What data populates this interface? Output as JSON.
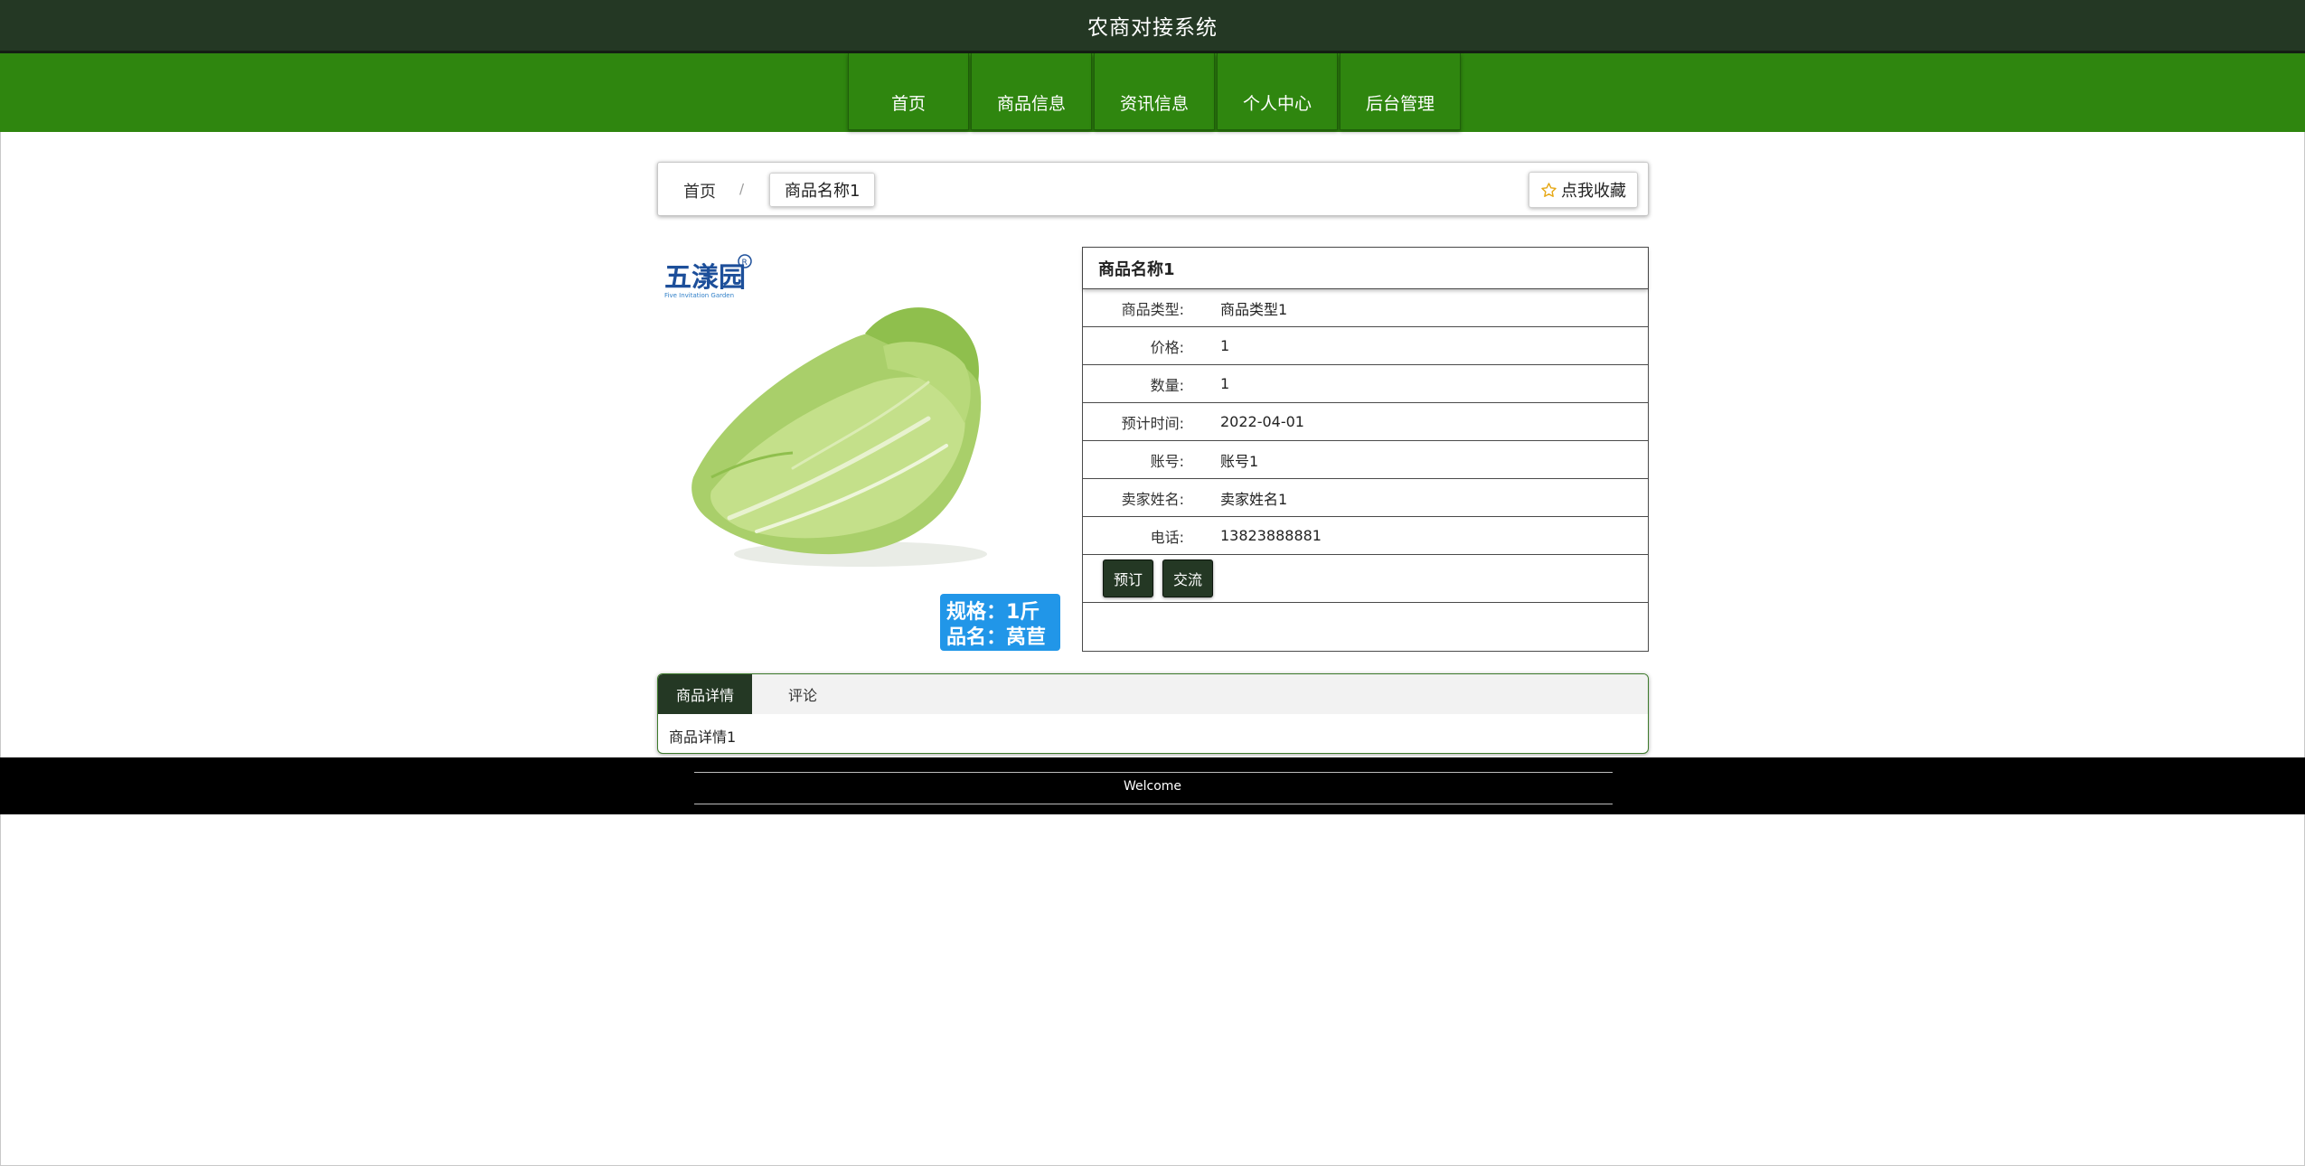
{
  "header": {
    "title": "农商对接系统"
  },
  "nav": {
    "items": [
      {
        "label": "首页"
      },
      {
        "label": "商品信息"
      },
      {
        "label": "资讯信息"
      },
      {
        "label": "个人中心"
      },
      {
        "label": "后台管理"
      }
    ]
  },
  "breadcrumb": {
    "home": "首页",
    "separator": "/",
    "current": "商品名称1"
  },
  "favorite": {
    "label": "点我收藏",
    "icon": "star-outline-icon"
  },
  "image": {
    "logo_text": "五漾园",
    "logo_sub": "Five Invitation Garden",
    "tag_line1": "规格：1斤",
    "tag_line2": "品名：莴苣"
  },
  "product": {
    "name": "商品名称1",
    "fields": [
      {
        "label": "商品类型:",
        "value": "商品类型1"
      },
      {
        "label": "价格:",
        "value": "1"
      },
      {
        "label": "数量:",
        "value": "1"
      },
      {
        "label": "预计时间:",
        "value": "2022-04-01"
      },
      {
        "label": "账号:",
        "value": "账号1"
      },
      {
        "label": "卖家姓名:",
        "value": "卖家姓名1"
      },
      {
        "label": "电话:",
        "value": "13823888881"
      }
    ],
    "actions": {
      "reserve": "预订",
      "chat": "交流"
    }
  },
  "tabs": {
    "items": [
      {
        "label": "商品详情"
      },
      {
        "label": "评论"
      }
    ],
    "content": "商品详情1"
  },
  "footer": {
    "text": "Welcome"
  }
}
